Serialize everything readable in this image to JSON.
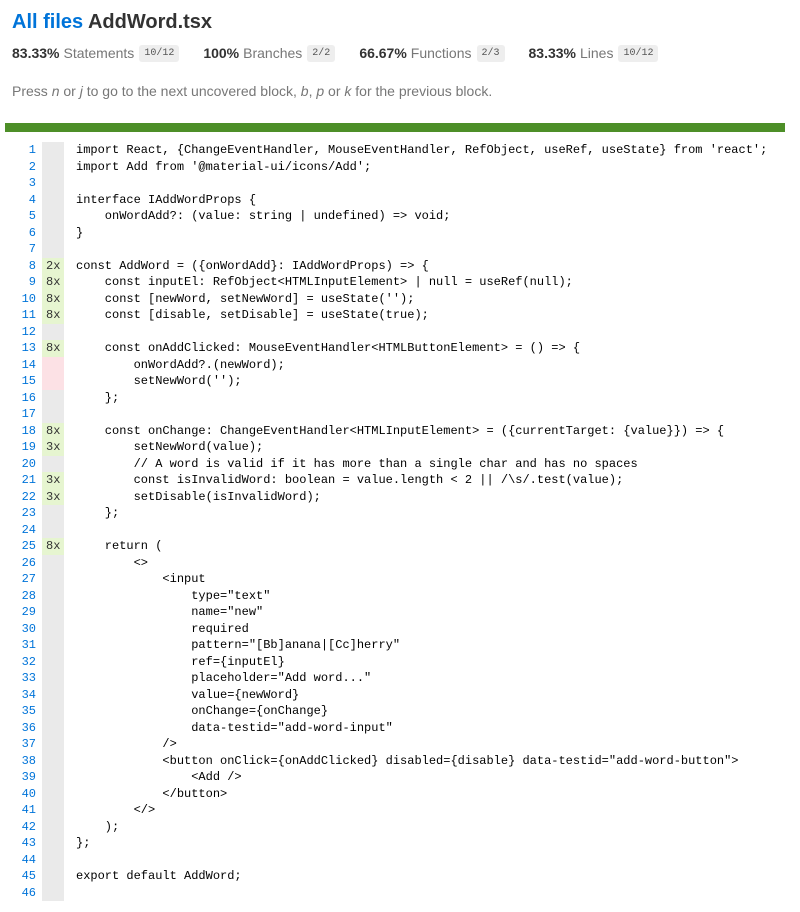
{
  "header": {
    "all_files": "All files",
    "file_name": "AddWord.tsx"
  },
  "metrics": [
    {
      "pct": "83.33%",
      "label": "Statements",
      "frac": "10/12"
    },
    {
      "pct": "100%",
      "label": "Branches",
      "frac": "2/2"
    },
    {
      "pct": "66.67%",
      "label": "Functions",
      "frac": "2/3"
    },
    {
      "pct": "83.33%",
      "label": "Lines",
      "frac": "10/12"
    }
  ],
  "help": {
    "p1": "Press ",
    "k1": "n",
    "p2": " or ",
    "k2": "j",
    "p3": " to go to the next uncovered block, ",
    "k3": "b",
    "p4": ", ",
    "k4": "p",
    "p5": " or ",
    "k5": "k",
    "p6": " for the previous block."
  },
  "colors": {
    "coverage_bar": "#4d8f28",
    "covered_count_bg": "#e6f5d0",
    "uncovered_bg": "#f6c6ce",
    "link": "#0074D9"
  },
  "lines": [
    {
      "n": "1",
      "c": "",
      "t": "import React, {ChangeEventHandler, MouseEventHandler, RefObject, useRef, useState} from 'react';"
    },
    {
      "n": "2",
      "c": "",
      "t": "import Add from '@material-ui/icons/Add';"
    },
    {
      "n": "3",
      "c": "",
      "t": ""
    },
    {
      "n": "4",
      "c": "",
      "t": "interface IAddWordProps {"
    },
    {
      "n": "5",
      "c": "",
      "t": "    onWordAdd?: (value: string | undefined) => void;"
    },
    {
      "n": "6",
      "c": "",
      "t": "}"
    },
    {
      "n": "7",
      "c": "",
      "t": ""
    },
    {
      "n": "8",
      "c": "2x",
      "t": "const AddWord = ({onWordAdd}: IAddWordProps) => {"
    },
    {
      "n": "9",
      "c": "8x",
      "t": "    const inputEl: RefObject<HTMLInputElement> | null = useRef(null);"
    },
    {
      "n": "10",
      "c": "8x",
      "t": "    const [newWord, setNewWord] = useState('');"
    },
    {
      "n": "11",
      "c": "8x",
      "t": "    const [disable, setDisable] = useState(true);"
    },
    {
      "n": "12",
      "c": "",
      "t": ""
    },
    {
      "n": "13",
      "c": "8x",
      "t": "    const onAddClicked: MouseEventHandler<HTMLButtonElement> = () => {"
    },
    {
      "n": "14",
      "c": "",
      "t": "        onWordAdd?.(newWord);"
    },
    {
      "n": "15",
      "c": "",
      "t": "        setNewWord('');"
    },
    {
      "n": "16",
      "c": "",
      "t": "    };"
    },
    {
      "n": "17",
      "c": "",
      "t": ""
    },
    {
      "n": "18",
      "c": "8x",
      "t": "    const onChange: ChangeEventHandler<HTMLInputElement> = ({currentTarget: {value}}) => {"
    },
    {
      "n": "19",
      "c": "3x",
      "t": "        setNewWord(value);"
    },
    {
      "n": "20",
      "c": "",
      "t": "        // A word is valid if it has more than a single char and has no spaces"
    },
    {
      "n": "21",
      "c": "3x",
      "t": "        const isInvalidWord: boolean = value.length < 2 || /\\s/.test(value);"
    },
    {
      "n": "22",
      "c": "3x",
      "t": "        setDisable(isInvalidWord);"
    },
    {
      "n": "23",
      "c": "",
      "t": "    };"
    },
    {
      "n": "24",
      "c": "",
      "t": ""
    },
    {
      "n": "25",
      "c": "8x",
      "t": "    return ("
    },
    {
      "n": "26",
      "c": "",
      "t": "        <>"
    },
    {
      "n": "27",
      "c": "",
      "t": "            <input"
    },
    {
      "n": "28",
      "c": "",
      "t": "                type=\"text\""
    },
    {
      "n": "29",
      "c": "",
      "t": "                name=\"new\""
    },
    {
      "n": "30",
      "c": "",
      "t": "                required"
    },
    {
      "n": "31",
      "c": "",
      "t": "                pattern=\"[Bb]anana|[Cc]herry\""
    },
    {
      "n": "32",
      "c": "",
      "t": "                ref={inputEl}"
    },
    {
      "n": "33",
      "c": "",
      "t": "                placeholder=\"Add word...\""
    },
    {
      "n": "34",
      "c": "",
      "t": "                value={newWord}"
    },
    {
      "n": "35",
      "c": "",
      "t": "                onChange={onChange}"
    },
    {
      "n": "36",
      "c": "",
      "t": "                data-testid=\"add-word-input\""
    },
    {
      "n": "37",
      "c": "",
      "t": "            />"
    },
    {
      "n": "38",
      "c": "",
      "t": "            <button onClick={onAddClicked} disabled={disable} data-testid=\"add-word-button\">"
    },
    {
      "n": "39",
      "c": "",
      "t": "                <Add />"
    },
    {
      "n": "40",
      "c": "",
      "t": "            </button>"
    },
    {
      "n": "41",
      "c": "",
      "t": "        </>"
    },
    {
      "n": "42",
      "c": "",
      "t": "    );"
    },
    {
      "n": "43",
      "c": "",
      "t": "};"
    },
    {
      "n": "44",
      "c": "",
      "t": ""
    },
    {
      "n": "45",
      "c": "",
      "t": "export default AddWord;"
    },
    {
      "n": "46",
      "c": "",
      "t": ""
    }
  ]
}
